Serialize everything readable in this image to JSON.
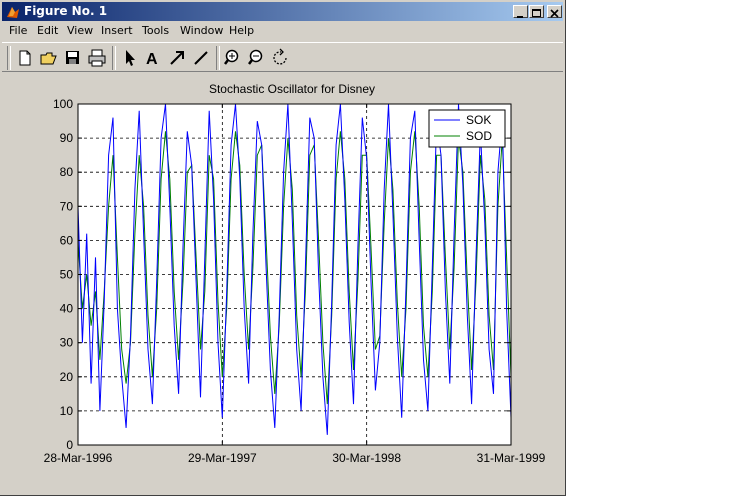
{
  "window": {
    "title": "Figure No. 1"
  },
  "menu": [
    "File",
    "Edit",
    "View",
    "Insert",
    "Tools",
    "Window",
    "Help"
  ],
  "toolbar": {
    "tools": [
      "new-file",
      "open-folder",
      "save",
      "print",
      "select-arrow",
      "insert-text",
      "insert-arrow",
      "insert-line",
      "zoom-in",
      "zoom-out",
      "rotate-3d"
    ]
  },
  "chart_data": {
    "type": "line",
    "title": "Stochastic Oscillator for Disney",
    "xlabel": "",
    "ylabel": "",
    "ylim": [
      0,
      100
    ],
    "yticks": [
      0,
      10,
      20,
      30,
      40,
      50,
      60,
      70,
      80,
      90,
      100
    ],
    "xticks": [
      "28-Mar-1996",
      "29-Mar-1997",
      "30-Mar-1998",
      "31-Mar-1999"
    ],
    "grid": true,
    "legend": "top-right",
    "series": [
      {
        "name": "SOK",
        "color": "#0000ff",
        "values": [
          70,
          30,
          62,
          18,
          55,
          10,
          42,
          85,
          96,
          40,
          20,
          5,
          32,
          75,
          98,
          62,
          28,
          12,
          48,
          90,
          100,
          70,
          35,
          15,
          58,
          92,
          82,
          48,
          14,
          55,
          98,
          72,
          30,
          8,
          45,
          88,
          100,
          78,
          40,
          18,
          62,
          95,
          88,
          52,
          22,
          5,
          38,
          80,
          100,
          66,
          28,
          10,
          52,
          96,
          90,
          50,
          20,
          3,
          42,
          88,
          100,
          72,
          36,
          12,
          58,
          96,
          84,
          48,
          16,
          30,
          75,
          100,
          68,
          32,
          8,
          46,
          90,
          98,
          60,
          25,
          10,
          52,
          95,
          85,
          45,
          18,
          62,
          100,
          76,
          38,
          12,
          55,
          92,
          65,
          28,
          15,
          80,
          96,
          40,
          8
        ]
      },
      {
        "name": "SOD",
        "color": "#008000",
        "values": [
          60,
          40,
          50,
          35,
          45,
          25,
          45,
          70,
          85,
          55,
          28,
          18,
          30,
          62,
          85,
          70,
          38,
          20,
          40,
          78,
          92,
          78,
          45,
          25,
          48,
          80,
          82,
          55,
          28,
          45,
          85,
          78,
          42,
          20,
          40,
          78,
          92,
          82,
          50,
          28,
          52,
          85,
          88,
          60,
          32,
          15,
          35,
          70,
          90,
          75,
          38,
          20,
          45,
          85,
          88,
          60,
          30,
          12,
          38,
          78,
          92,
          78,
          45,
          22,
          48,
          85,
          85,
          58,
          28,
          32,
          65,
          90,
          75,
          42,
          20,
          40,
          80,
          92,
          70,
          35,
          20,
          45,
          85,
          85,
          55,
          28,
          52,
          90,
          80,
          48,
          22,
          48,
          85,
          72,
          38,
          22,
          70,
          90,
          55,
          20
        ]
      }
    ]
  }
}
